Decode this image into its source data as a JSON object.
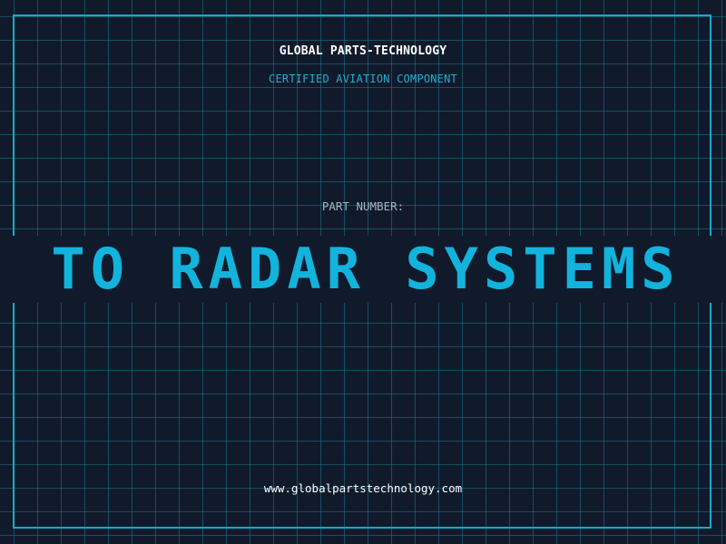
{
  "header": {
    "brand": "GLOBAL PARTS-TECHNOLOGY",
    "subtitle": "CERTIFIED AVIATION COMPONENT"
  },
  "main": {
    "part_label": "PART NUMBER:",
    "part_number": "TO RADAR SYSTEMS"
  },
  "footer": {
    "website": "www.globalpartstechnology.com"
  },
  "colors": {
    "background": "#111a2b",
    "grid": "#18788c",
    "accent": "#12b3dc",
    "frame": "#19a9c9",
    "text": "#ffffff",
    "muted": "#aab4c2"
  }
}
